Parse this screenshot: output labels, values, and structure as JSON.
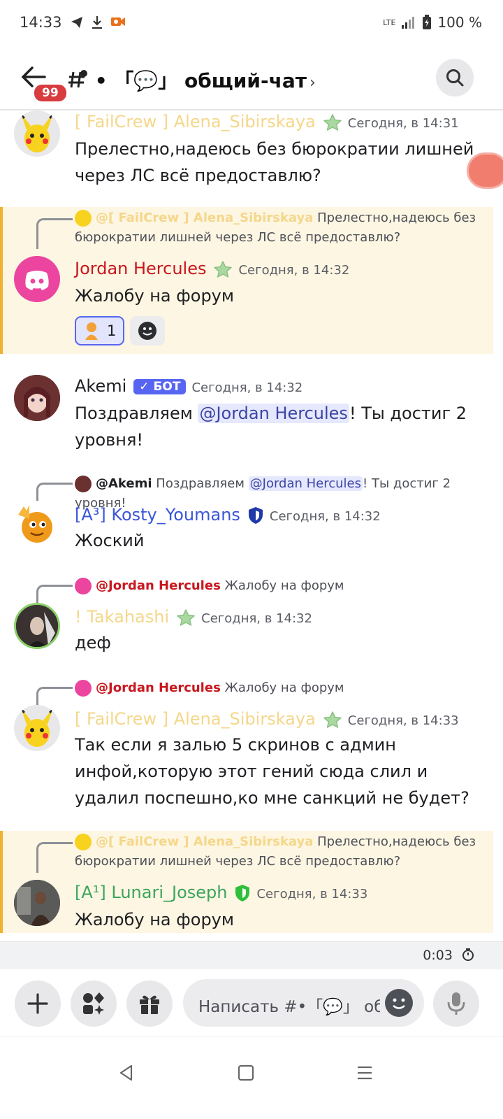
{
  "status": {
    "time": "14:33",
    "network": "LTE",
    "battery": "100 %"
  },
  "header": {
    "unread_badge": "99",
    "channel": "• 「💬」 общий-чат"
  },
  "messages": [
    {
      "author": "[ FailCrew ] Alena_Sibirskaya",
      "timestamp": "Сегодня, в 14:31",
      "text": "Прелестно,надеюсь без бюрократии лишней через ЛС всё предоставлю?"
    },
    {
      "reply_author": "@[ FailCrew ] Alena_Sibirskaya",
      "reply_text": "Прелестно,надеюсь без бюрократии лишней через ЛС всё предоставлю?",
      "author": "Jordan Hercules",
      "timestamp": "Сегодня, в 14:32",
      "text": "Жалобу на форум",
      "reaction_count": "1"
    },
    {
      "author": "Akemi",
      "bot_badge": "✓ БОТ",
      "timestamp": "Сегодня, в 14:32",
      "text_before": "Поздравляем ",
      "mention": "@Jordan Hercules",
      "text_after": "! Ты достиг 2 уровня!"
    },
    {
      "reply_author": "@Akemi",
      "reply_before": "Поздравляем ",
      "reply_mention": "@Jordan Hercules",
      "reply_after": "! Ты достиг 2 уровня!",
      "author": "[A³] Kosty_Youmans",
      "timestamp": "Сегодня, в 14:32",
      "text": "Жоский"
    },
    {
      "reply_author": "@Jordan Hercules",
      "reply_text": "Жалобу на форум",
      "author": "! Takahashi",
      "timestamp": "Сегодня, в 14:32",
      "text": "деф"
    },
    {
      "reply_author": "@Jordan Hercules",
      "reply_text": "Жалобу на форум",
      "author": "[ FailCrew ] Alena_Sibirskaya",
      "timestamp": "Сегодня, в 14:33",
      "text": "Так если я залью 5 скринов с админ инфой,которую этот гений сюда слил и удалил поспешно,ко мне санкций не будет?"
    },
    {
      "reply_author": "@[ FailCrew ] Alena_Sibirskaya",
      "reply_text": "Прелестно,надеюсь без бюрократии лишней через ЛС всё предоставлю?",
      "author": "[A¹] Lunari_Joseph",
      "timestamp": "Сегодня, в 14:33",
      "text": "Жалобу на форум"
    }
  ],
  "timer": "0:03",
  "composer": {
    "placeholder": "Написать #•「💬」 общий-чат"
  },
  "colors": {
    "gold": "#f5d78a",
    "red": "#c8171e",
    "blue": "#3b55d9",
    "green": "#3ba55c",
    "discord_pink": "#eb459f",
    "blurple": "#5865f2"
  }
}
